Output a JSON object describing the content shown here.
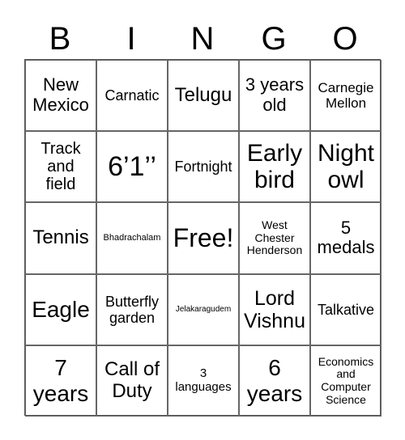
{
  "header": [
    "B",
    "I",
    "N",
    "G",
    "O"
  ],
  "cells": [
    "New\nMexico",
    "Carnatic",
    "Telugu",
    "3 years\nold",
    "Carnegie\nMellon",
    "Track\nand\nfield",
    "6’1’’",
    "Fortnight",
    "Early\nbird",
    "Night\nowl",
    "Tennis",
    "Bhadrachalam",
    "Free!",
    "West\nChester\nHenderson",
    "5\nmedals",
    "Eagle",
    "Butterfly\ngarden",
    "Jelakaragudem",
    "Lord\nVishnu",
    "Talkative",
    "7\nyears",
    "Call of\nDuty",
    "3\nlanguages",
    "6\nyears",
    "Economics\nand\nComputer\nScience"
  ]
}
